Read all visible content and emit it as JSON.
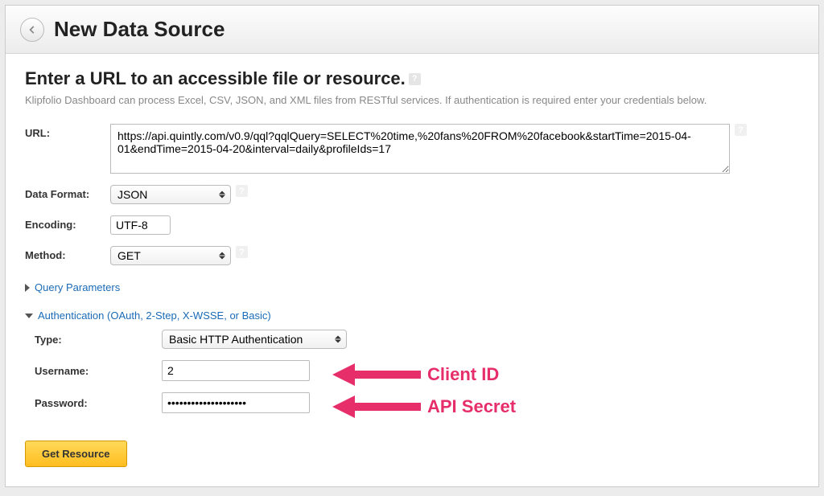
{
  "header": {
    "title": "New Data Source"
  },
  "section": {
    "title": "Enter a URL to an accessible file or resource.",
    "subtitle": "Klipfolio Dashboard can process Excel, CSV, JSON, and XML files from RESTful services. If authentication is required enter your credentials below."
  },
  "form": {
    "url_label": "URL:",
    "url_value": "https://api.quintly.com/v0.9/qql?qqlQuery=SELECT%20time,%20fans%20FROM%20facebook&startTime=2015-04-01&endTime=2015-04-20&interval=daily&profileIds=17",
    "data_format_label": "Data Format:",
    "data_format_value": "JSON",
    "encoding_label": "Encoding:",
    "encoding_value": "UTF-8",
    "method_label": "Method:",
    "method_value": "GET"
  },
  "collapsibles": {
    "query_params": "Query Parameters",
    "auth": "Authentication (OAuth, 2-Step, X-WSSE, or Basic)"
  },
  "auth": {
    "type_label": "Type:",
    "type_value": "Basic HTTP Authentication",
    "username_label": "Username:",
    "username_value": "2",
    "password_label": "Password:",
    "password_value": "••••••••••••••••••••"
  },
  "annotations": {
    "client_id": "Client ID",
    "api_secret": "API Secret"
  },
  "actions": {
    "submit": "Get Resource"
  }
}
